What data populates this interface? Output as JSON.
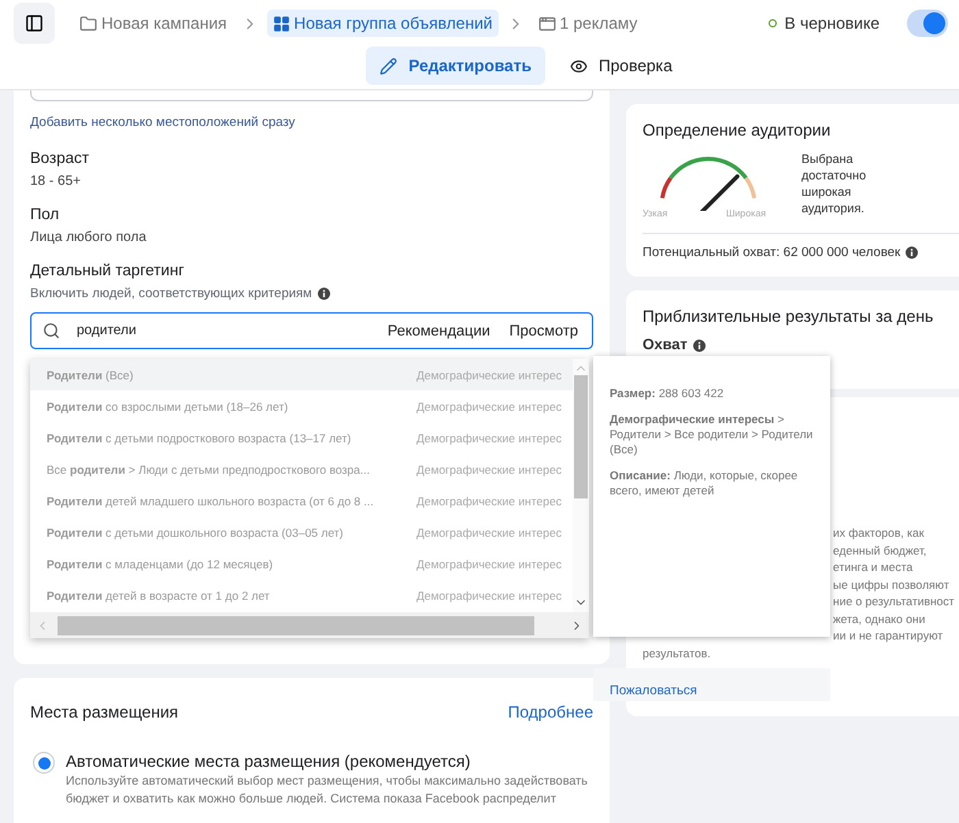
{
  "breadcrumbs": [
    {
      "label": "Новая кампания",
      "kind": "campaign",
      "selected": false
    },
    {
      "label": "Новая группа объявлений",
      "kind": "adset",
      "selected": true
    },
    {
      "label": "1 рекламу",
      "kind": "ad",
      "selected": false
    }
  ],
  "status": {
    "label": "В черновике",
    "on": true
  },
  "mode_tabs": [
    {
      "label": "Редактировать",
      "kind": "edit",
      "selected": true
    },
    {
      "label": "Проверка",
      "kind": "review",
      "selected": false
    }
  ],
  "audience_form": {
    "locations_link": "Добавить несколько местоположений сразу",
    "fields": [
      {
        "label": "Возраст",
        "value": "18 - 65+"
      },
      {
        "label": "Пол",
        "value": "Лица любого пола"
      }
    ],
    "detailed_targeting": {
      "title": "Детальный таргетинг",
      "subtitle": "Включить людей, соответствующих критериям",
      "search": {
        "value": "родители",
        "actions": [
          "Рекомендации",
          "Просмотр"
        ]
      },
      "suggestions": [
        {
          "name": "**Родители** (Все)",
          "category": "Демографические интерес",
          "selected": true
        },
        {
          "name": "**Родители** со взрослыми детьми (18–26 лет)",
          "category": "Демографические интерес",
          "selected": false
        },
        {
          "name": "**Родители** с детьми подросткового возраста (13–17 лет)",
          "category": "Демографические интерес",
          "selected": false
        },
        {
          "name": "Все **родители** > Люди с детьми предподросткового возра...",
          "category": "Демографические интерес",
          "selected": false
        },
        {
          "name": "**Родители** детей младшего школьного возраста (от 6 до 8 ...",
          "category": "Демографические интерес",
          "selected": false
        },
        {
          "name": "**Родители** с детьми дошкольного возраста (03–05 лет)",
          "category": "Демографические интерес",
          "selected": false
        },
        {
          "name": "**Родители** с младенцами (до 12 месяцев)",
          "category": "Демографические интерес",
          "selected": false
        },
        {
          "name": "**Родители** детей в возрасте от 1 до 2 лет",
          "category": "Демографические интерес",
          "selected": false
        }
      ]
    }
  },
  "placements": {
    "title": "Места размещения",
    "link": "Подробнее",
    "options": [
      {
        "label": "Автоматические места размещения (рекомендуется)",
        "description": "Используйте автоматический выбор мест размещения, чтобы максимально задействовать бюджет и охватить как можно больше людей. Система показа Facebook распределит",
        "selected": true
      }
    ]
  },
  "audience_definition": {
    "title": "Определение аудитории",
    "gauge": {
      "level": 0.75,
      "min_label": "Узкая",
      "max_label": "Широкая"
    },
    "verdict": "Выбрана достаточно широкая аудитория.",
    "potential_reach": "Потенциальный охват: 62 000 000 человек"
  },
  "daily_results": {
    "title": "Приблизительные результаты за день",
    "metric": "Охват",
    "note_fragments": [
      "их факторов, как",
      "еденный бюджет,",
      "етинга и места",
      "ые цифры позволяют",
      "ние о результативност",
      "жета, однако они",
      "ии и не гарантируют"
    ],
    "note_end": "результатов."
  },
  "tooltip": {
    "size": "**Размер:** 288 603 422",
    "path": "**Демографические интересы** > Родители > Все родители > Родители (Все)",
    "description": "**Описание:** Люди, которые, скорее всего, имеют детей",
    "report_link": "Пожаловаться"
  }
}
